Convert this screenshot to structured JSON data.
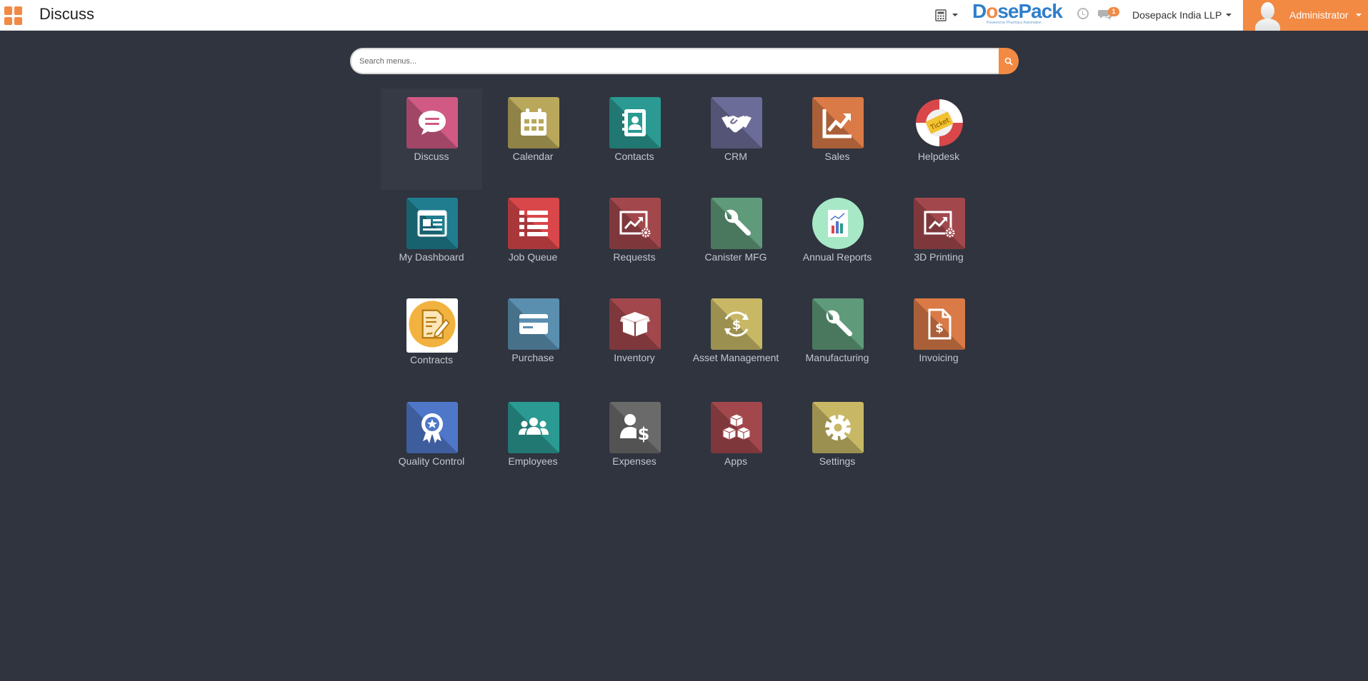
{
  "header": {
    "app_title": "Discuss",
    "logo_brand_prefix": "D",
    "logo_brand_o": "o",
    "logo_brand_suffix": "sePack",
    "logo_tagline": "Powered by Pharmacy Automation",
    "message_count": "1",
    "company_name": "Dosepack India LLP",
    "user_name": "Administrator"
  },
  "search": {
    "placeholder": "Search menus..."
  },
  "apps": [
    {
      "label": "Discuss",
      "color": "#d05a84",
      "icon": "chat-bubble-icon"
    },
    {
      "label": "Calendar",
      "color": "#b9a85c",
      "icon": "calendar-icon"
    },
    {
      "label": "Contacts",
      "color": "#2a9a92",
      "icon": "address-book-icon"
    },
    {
      "label": "CRM",
      "color": "#6c6c98",
      "icon": "handshake-icon"
    },
    {
      "label": "Sales",
      "color": "#d97a47",
      "icon": "trending-chart-icon"
    },
    {
      "label": "Helpdesk",
      "color": "#ffffff",
      "icon": "lifebuoy-ticket-icon"
    },
    {
      "label": "My Dashboard",
      "color": "#1f7d8f",
      "icon": "dashboard-window-icon"
    },
    {
      "label": "Job Queue",
      "color": "#d9474a",
      "icon": "list-icon"
    },
    {
      "label": "Requests",
      "color": "#a2484d",
      "icon": "chart-gear-icon"
    },
    {
      "label": "Canister MFG",
      "color": "#5f9a7a",
      "icon": "wrench-icon"
    },
    {
      "label": "Annual Reports",
      "color": "#a7e8c6",
      "icon": "report-chart-icon"
    },
    {
      "label": "3D Printing",
      "color": "#a2484d",
      "icon": "chart-gear-icon"
    },
    {
      "label": "Contracts",
      "color": "#f2b23f",
      "icon": "contract-sign-icon"
    },
    {
      "label": "Purchase",
      "color": "#5b8fb0",
      "icon": "credit-card-icon"
    },
    {
      "label": "Inventory",
      "color": "#a2484d",
      "icon": "box-icon"
    },
    {
      "label": "Asset Management",
      "color": "#c8b866",
      "icon": "dollar-cycle-icon"
    },
    {
      "label": "Manufacturing",
      "color": "#5f9a7a",
      "icon": "wrench-icon"
    },
    {
      "label": "Invoicing",
      "color": "#d97a47",
      "icon": "invoice-dollar-icon"
    },
    {
      "label": "Quality Control",
      "color": "#4f77c9",
      "icon": "award-ribbon-icon"
    },
    {
      "label": "Employees",
      "color": "#2a9a92",
      "icon": "users-group-icon"
    },
    {
      "label": "Expenses",
      "color": "#6a6a6a",
      "icon": "user-dollar-icon"
    },
    {
      "label": "Apps",
      "color": "#a2484d",
      "icon": "cubes-icon"
    },
    {
      "label": "Settings",
      "color": "#c8b866",
      "icon": "gear-icon"
    }
  ]
}
